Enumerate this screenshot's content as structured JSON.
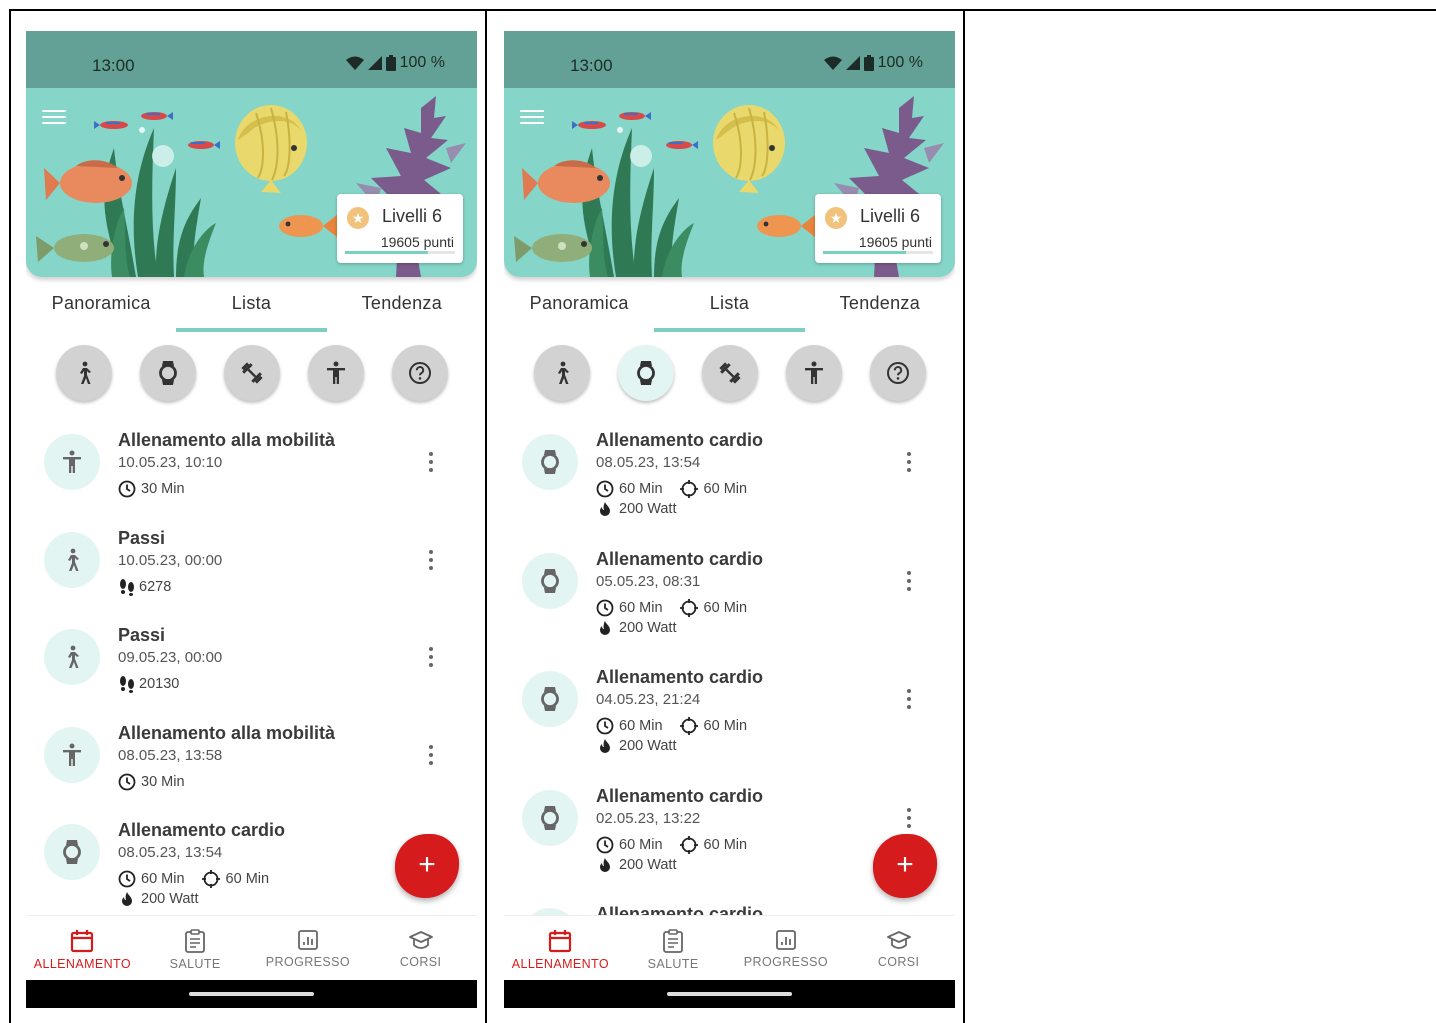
{
  "colors": {
    "accent": "#d51b1b",
    "teal": "#85d5c8",
    "status_bar": "#63a196",
    "tab_indicator": "#7ecdc2"
  },
  "screens": [
    {
      "status": {
        "time": "13:00",
        "battery": "100 %"
      },
      "level": {
        "title": "Livelli 6",
        "points": "19605 punti",
        "progress": 0.75
      },
      "tabs": [
        "Panoramica",
        "Lista",
        "Tendenza"
      ],
      "active_tab": 1,
      "filters": [
        {
          "icon": "walking-icon",
          "selected": false
        },
        {
          "icon": "watch-icon",
          "selected": false
        },
        {
          "icon": "dumbbell-icon",
          "selected": false
        },
        {
          "icon": "person-icon",
          "selected": false
        },
        {
          "icon": "help-icon",
          "selected": false
        }
      ],
      "items": [
        {
          "icon": "person-icon",
          "title": "Allenamento alla mobilità",
          "date": "10.05.23, 10:10",
          "duration": "30 Min"
        },
        {
          "icon": "walking-icon",
          "title": "Passi",
          "date": "10.05.23, 00:00",
          "steps": "6278"
        },
        {
          "icon": "walking-icon",
          "title": "Passi",
          "date": "09.05.23, 00:00",
          "steps": "20130"
        },
        {
          "icon": "person-icon",
          "title": "Allenamento alla mobilità",
          "date": "08.05.23, 13:58",
          "duration": "30 Min"
        },
        {
          "icon": "watch-icon",
          "title": "Allenamento cardio",
          "date": "08.05.23, 13:54",
          "duration": "60 Min",
          "target": "60 Min",
          "power": "200 Watt"
        }
      ],
      "fab": "+",
      "nav": [
        "ALLENAMENTO",
        "SALUTE",
        "PROGRESSO",
        "CORSI"
      ]
    },
    {
      "status": {
        "time": "13:00",
        "battery": "100 %"
      },
      "level": {
        "title": "Livelli 6",
        "points": "19605 punti",
        "progress": 0.75
      },
      "tabs": [
        "Panoramica",
        "Lista",
        "Tendenza"
      ],
      "active_tab": 1,
      "filters": [
        {
          "icon": "walking-icon",
          "selected": false
        },
        {
          "icon": "watch-icon",
          "selected": true
        },
        {
          "icon": "dumbbell-icon",
          "selected": false
        },
        {
          "icon": "person-icon",
          "selected": false
        },
        {
          "icon": "help-icon",
          "selected": false
        }
      ],
      "items": [
        {
          "icon": "watch-icon",
          "title": "Allenamento cardio",
          "date": "08.05.23, 13:54",
          "duration": "60 Min",
          "target": "60 Min",
          "power": "200 Watt"
        },
        {
          "icon": "watch-icon",
          "title": "Allenamento cardio",
          "date": "05.05.23, 08:31",
          "duration": "60 Min",
          "target": "60 Min",
          "power": "200 Watt"
        },
        {
          "icon": "watch-icon",
          "title": "Allenamento cardio",
          "date": "04.05.23, 21:24",
          "duration": "60 Min",
          "target": "60 Min",
          "power": "200 Watt"
        },
        {
          "icon": "watch-icon",
          "title": "Allenamento cardio",
          "date": "02.05.23, 13:22",
          "duration": "60 Min",
          "target": "60 Min",
          "power": "200 Watt"
        },
        {
          "icon": "watch-icon",
          "title": "Allenamento cardio",
          "date": "",
          "duration": "",
          "target": "",
          "power": ""
        }
      ],
      "fab": "+",
      "nav": [
        "ALLENAMENTO",
        "SALUTE",
        "PROGRESSO",
        "CORSI"
      ]
    }
  ]
}
